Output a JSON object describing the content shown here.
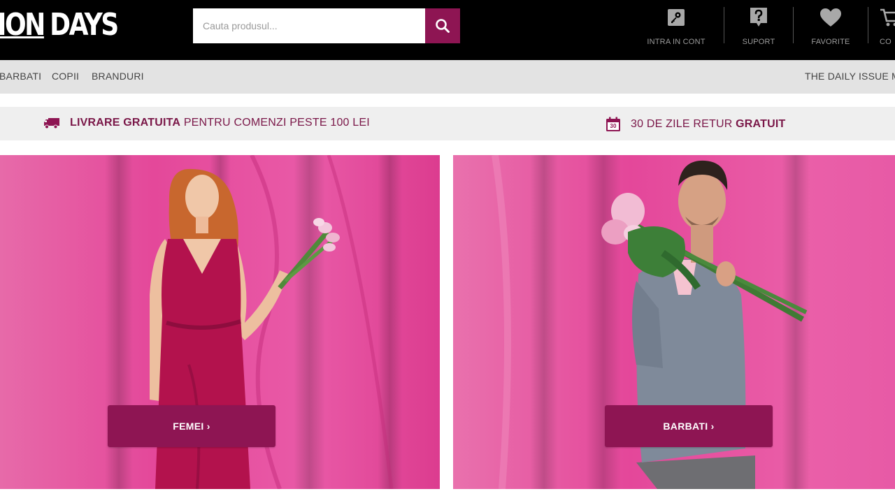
{
  "header": {
    "logo_part_a": "ION",
    "logo_part_b": "DAYS",
    "search": {
      "placeholder": "Cauta produsul..."
    },
    "nav": [
      {
        "label": "INTRA IN CONT",
        "icon": "key-icon"
      },
      {
        "label": "SUPORT",
        "icon": "question-icon"
      },
      {
        "label": "FAVORITE",
        "icon": "heart-icon"
      },
      {
        "label": "CO",
        "icon": "cart-icon"
      }
    ]
  },
  "categories": {
    "left": [
      "BARBATI",
      "COPII",
      "BRANDURI"
    ],
    "right": [
      "THE DAILY ISSUE",
      "M"
    ]
  },
  "info": {
    "shipping_bold": "LIVRARE GRATUITA",
    "shipping_rest": "PENTRU COMENZI PESTE 100 LEI",
    "return_rest": "30 DE ZILE RETUR",
    "return_bold": "GRATUIT",
    "calendar_day": "30"
  },
  "hero": {
    "women_cta": "FEMEI ›",
    "men_cta": "BARBATI ›"
  },
  "colors": {
    "brand": "#8e1553",
    "header_bg": "#000000",
    "catbar_bg": "#e3e3e3",
    "hero_pink": "#e8459a"
  }
}
